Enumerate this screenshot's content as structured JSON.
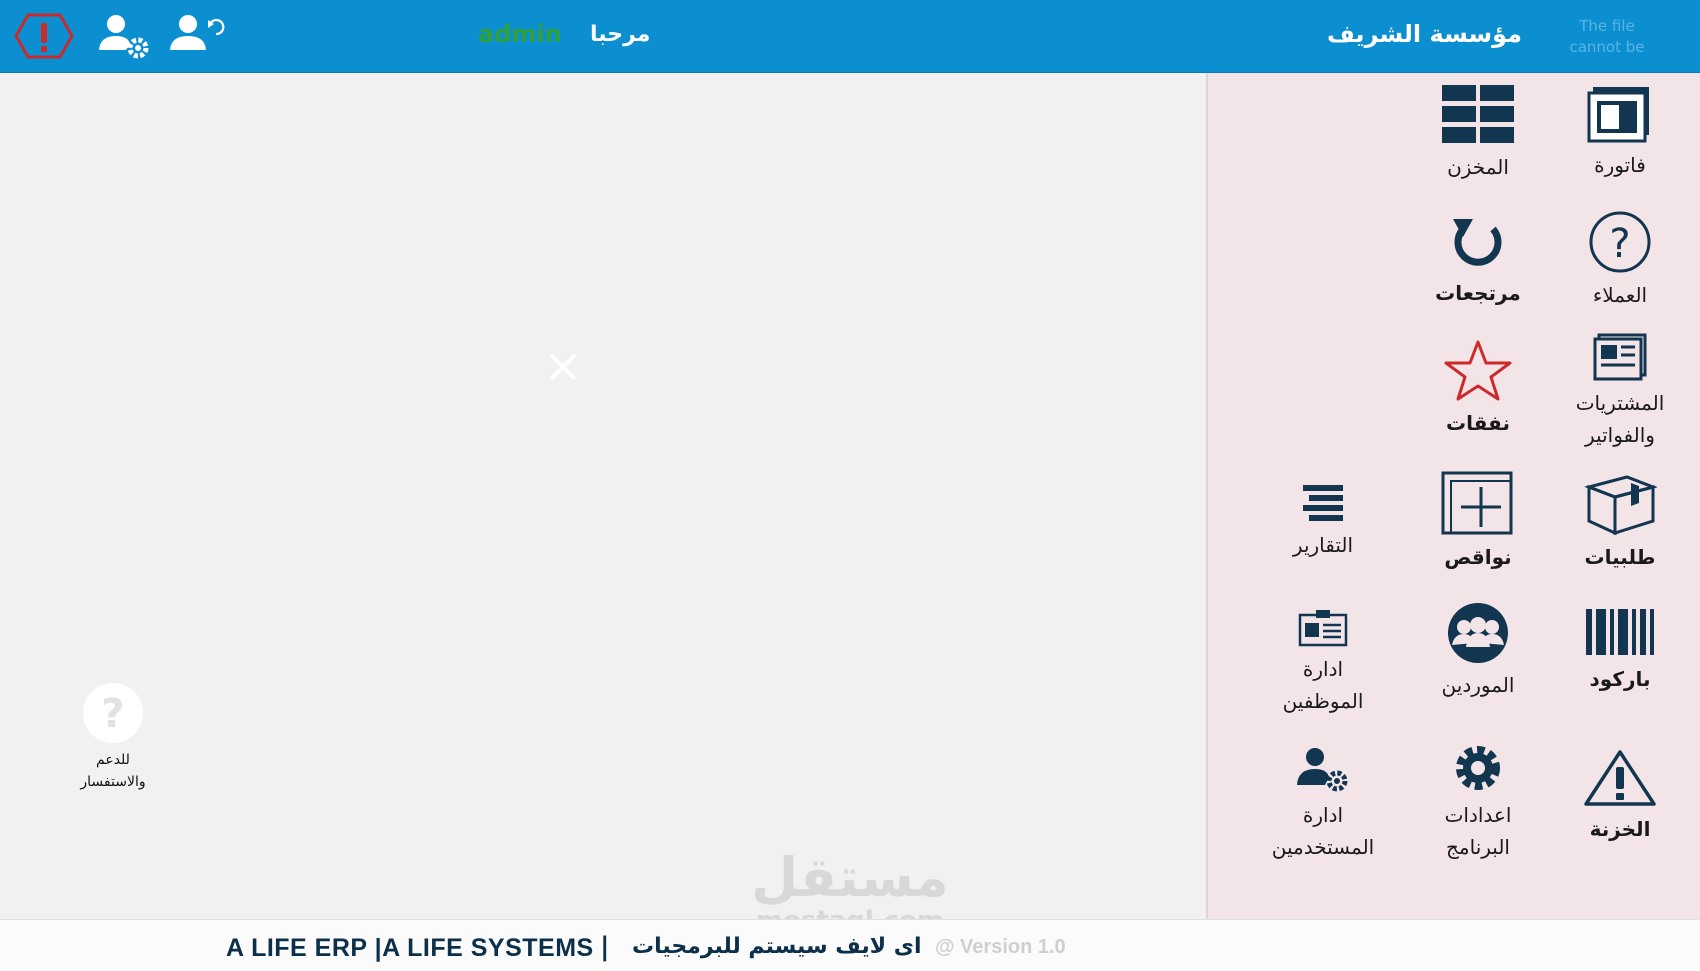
{
  "header": {
    "logo_alt": "The file cannot be",
    "company": "مؤسسة الشريف",
    "welcome": "مرحبا",
    "username": "admin"
  },
  "menu": {
    "invoice": "فاتورة",
    "warehouse": "المخزن",
    "customers": "العملاء",
    "returns": "مرتجعات",
    "purchases_line1": "المشتريات",
    "purchases_line2": "والفواتير",
    "expenses": "نفقات",
    "orders": "طلبيات",
    "shortages": "نواقص",
    "reports": "التقارير",
    "barcode": "باركود",
    "suppliers": "الموردين",
    "employees_line1": "ادارة",
    "employees_line2": "الموظفين",
    "treasury": "الخزنة",
    "settings_line1": "اعدادات",
    "settings_line2": "البرنامج",
    "users_line1": "ادارة",
    "users_line2": "المستخدمين"
  },
  "support": {
    "line1": "للدعم",
    "line2": "والاستفسار"
  },
  "footer": {
    "brand": "A LIFE ERP |A LIFE SYSTEMS",
    "separator": "|",
    "arabic": "اى لايف سيستم للبرمجيات",
    "version": "@ Version  1.0"
  },
  "watermark": {
    "main": "مستقل",
    "sub": "mostaql.com"
  },
  "colors": {
    "header_bg": "#0b8fd0",
    "icon_dark": "#123650",
    "accent_red": "#cc2a2a",
    "username_green": "#2fa03a"
  }
}
